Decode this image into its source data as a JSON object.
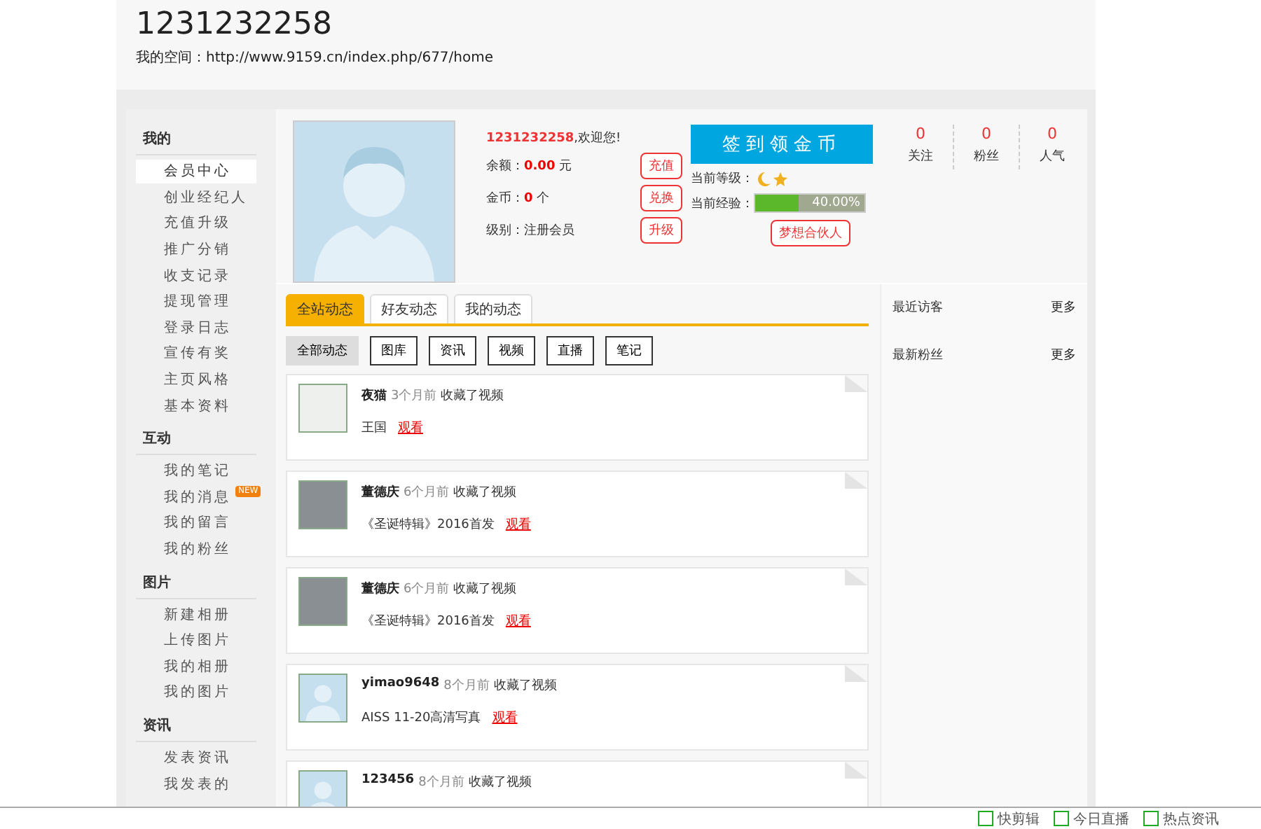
{
  "header": {
    "title": "1231232258",
    "space_link": "我的空间：http://www.9159.cn/index.php/677/home"
  },
  "sidebar": [
    {
      "title": "我的",
      "items": [
        {
          "label": "会员中心",
          "selected": true
        },
        {
          "label": "创业经纪人",
          "selected": false
        },
        {
          "label": "充值升级",
          "selected": false
        },
        {
          "label": "推广分销",
          "selected": false
        },
        {
          "label": "收支记录",
          "selected": false
        },
        {
          "label": "提现管理",
          "selected": false
        },
        {
          "label": "登录日志",
          "selected": false
        },
        {
          "label": "宣传有奖",
          "selected": false
        },
        {
          "label": "主页风格",
          "selected": false
        },
        {
          "label": "基本资料",
          "selected": false
        }
      ]
    },
    {
      "title": "互动",
      "items": [
        {
          "label": "我的笔记",
          "selected": false
        },
        {
          "label": "我的消息",
          "selected": false,
          "badge": "NEW"
        },
        {
          "label": "我的留言",
          "selected": false
        },
        {
          "label": "我的粉丝",
          "selected": false
        }
      ]
    },
    {
      "title": "图片",
      "items": [
        {
          "label": "新建相册",
          "selected": false
        },
        {
          "label": "上传图片",
          "selected": false
        },
        {
          "label": "我的相册",
          "selected": false
        },
        {
          "label": "我的图片",
          "selected": false
        }
      ]
    },
    {
      "title": "资讯",
      "items": [
        {
          "label": "发表资讯",
          "selected": false
        },
        {
          "label": "我发表的",
          "selected": false
        }
      ]
    }
  ],
  "profile": {
    "username": "1231232258",
    "greeting": ",欢迎您!",
    "rows": [
      {
        "label": "余额：",
        "value": "0.00",
        "unit": "元",
        "button": "充值"
      },
      {
        "label": "金币：",
        "value": "0",
        "unit": "个",
        "button": "兑换"
      },
      {
        "label": "级别：注册会员",
        "button": "升级"
      }
    ],
    "checkin_button": "签到领金币",
    "level_label": "当前等级：",
    "exp_label": "当前经验：",
    "exp": {
      "level": 0.4,
      "reading": "40.00%"
    },
    "partner_button": "梦想合伙人",
    "stats": [
      {
        "value": "0",
        "label": "关注"
      },
      {
        "value": "0",
        "label": "粉丝"
      },
      {
        "value": "0",
        "label": "人气"
      }
    ]
  },
  "tabs": [
    {
      "label": "全站动态",
      "selected": true
    },
    {
      "label": "好友动态",
      "selected": false
    },
    {
      "label": "我的动态",
      "selected": false
    }
  ],
  "filters": [
    {
      "label": "全部动态",
      "selected": true
    },
    {
      "label": "图库",
      "selected": false
    },
    {
      "label": "资讯",
      "selected": false
    },
    {
      "label": "视频",
      "selected": false
    },
    {
      "label": "直播",
      "selected": false
    },
    {
      "label": "笔记",
      "selected": false
    }
  ],
  "feed": [
    {
      "kind": "sketch",
      "user": "夜猫",
      "time": "3个月前",
      "action": "收藏了视频",
      "title": "王国",
      "link": "观看"
    },
    {
      "kind": "photo",
      "user": "董德庆",
      "time": "6个月前",
      "action": "收藏了视频",
      "title": "《圣诞特辑》2016首发",
      "link": "观看"
    },
    {
      "kind": "photo",
      "user": "董德庆",
      "time": "6个月前",
      "action": "收藏了视频",
      "title": "《圣诞特辑》2016首发",
      "link": "观看"
    },
    {
      "kind": "default",
      "user": "yimao9648",
      "time": "8个月前",
      "action": "收藏了视频",
      "title": "AISS 11-20高清写真",
      "link": "观看"
    },
    {
      "kind": "default",
      "user": "123456",
      "time": "8个月前",
      "action": "收藏了视频"
    }
  ],
  "side_panels": [
    {
      "title": "最近访客",
      "more": "更多"
    },
    {
      "title": "最新粉丝",
      "more": "更多"
    }
  ],
  "bottom_bar": [
    "快剪辑",
    "今日直播",
    "热点资讯"
  ]
}
